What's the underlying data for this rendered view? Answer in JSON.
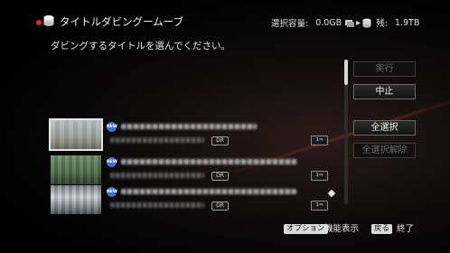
{
  "header": {
    "title": "タイトルダビングームーブ",
    "capacity_label": "選択容量:",
    "selected_size": "0.0GB",
    "remaining_label": "残:",
    "remaining_size": "1.9TB"
  },
  "instruction": "ダビングするタイトルを選んでください。",
  "actions": {
    "execute_label": "実行",
    "stop_label": "中止",
    "select_all_label": "全選択",
    "deselect_all_label": "全選択解除"
  },
  "titles": [
    {
      "new_badge": "NEW",
      "mode": "DR",
      "rec_icon": "1⇒",
      "selected": true
    },
    {
      "new_badge": "NEW",
      "mode": "DR",
      "rec_icon": "1⇒",
      "selected": false
    },
    {
      "new_badge": "NEW",
      "mode": "DR",
      "rec_icon": "1⇒",
      "selected": false
    }
  ],
  "footer": {
    "option_key": "オプション",
    "option_label": "機能表示",
    "back_key": "戻る",
    "back_label": "終了"
  },
  "colors": {
    "accent_red": "#e8262a",
    "new_badge_blue": "#3e6fd8"
  },
  "icons": [
    "disc-icon",
    "copy-arrow-icon",
    "hdd-icon",
    "diamond-icon"
  ]
}
